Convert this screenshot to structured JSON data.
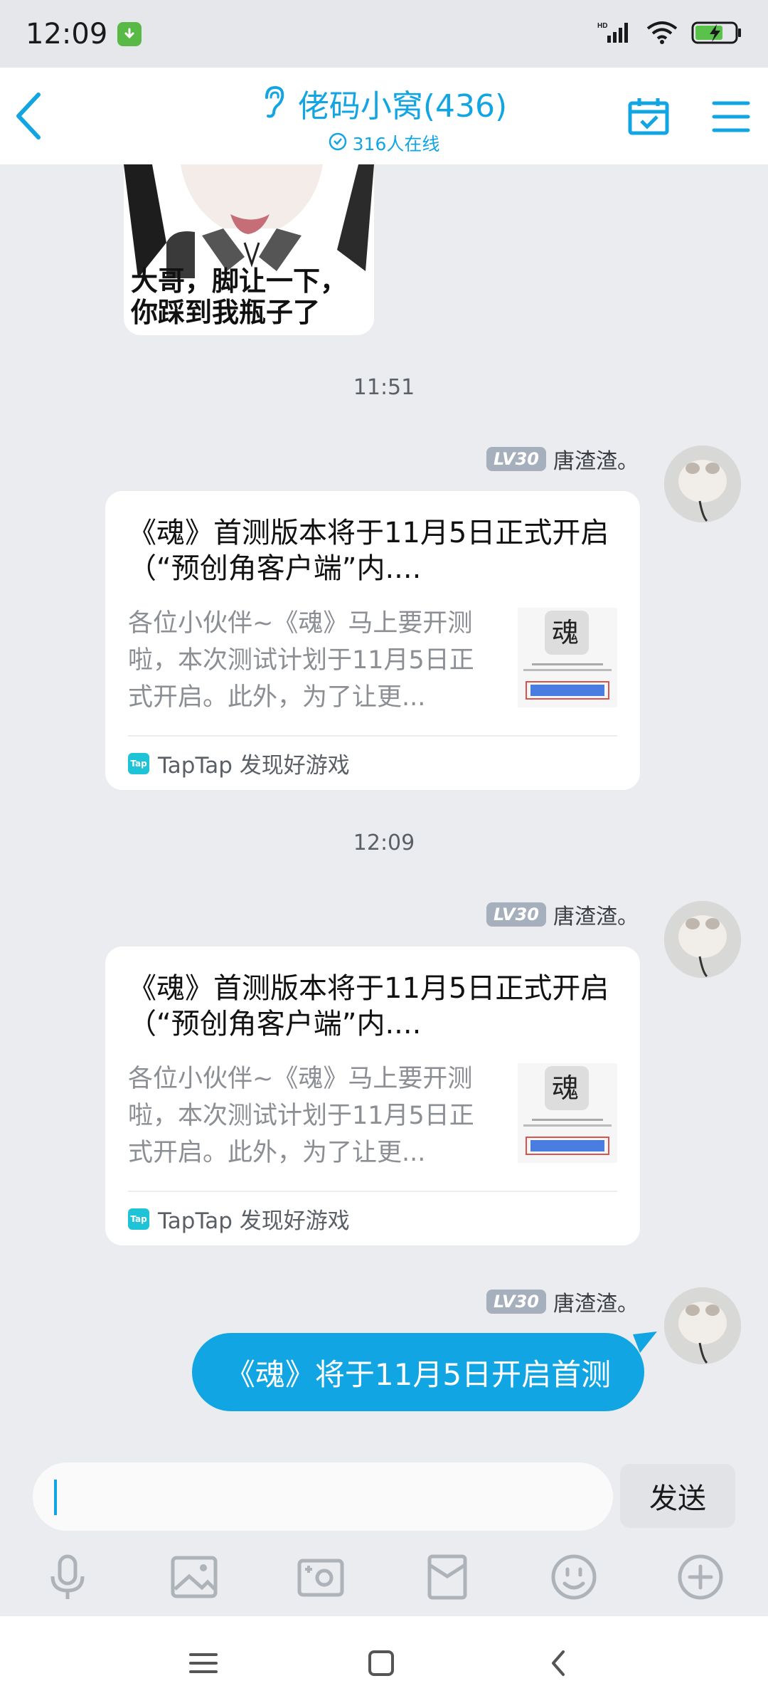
{
  "status_bar": {
    "time": "12:09",
    "icons": [
      "download-badge-icon",
      "hd-signal-icon",
      "wifi-icon",
      "battery-charging-icon"
    ]
  },
  "header": {
    "title": "佬码小窝(436)",
    "online_text": "316人在线",
    "icons": [
      "back-icon",
      "ear-icon",
      "check-circle-icon",
      "calendar-check-icon",
      "menu-icon"
    ],
    "accent_color": "#12a5e3"
  },
  "messages": [
    {
      "type": "sticker",
      "caption_line1": "大哥，脚让一下，",
      "caption_line2": "你踩到我瓶子了"
    },
    {
      "type": "time",
      "text": "11:51"
    },
    {
      "type": "card",
      "sender_level": "LV30",
      "sender_name": "唐渣渣。",
      "title": "《魂》首测版本将于11月5日正式开启（“预创角客户端”内....",
      "description": "各位小伙伴~《魂》马上要开测啦，本次测试计划于11月5日正式开启。此外，为了让更...",
      "source": "TapTap 发现好游戏"
    },
    {
      "type": "time",
      "text": "12:09"
    },
    {
      "type": "card",
      "sender_level": "LV30",
      "sender_name": "唐渣渣。",
      "title": "《魂》首测版本将于11月5日正式开启（“预创角客户端”内....",
      "description": "各位小伙伴~《魂》马上要开测啦，本次测试计划于11月5日正式开启。此外，为了让更...",
      "source": "TapTap 发现好游戏"
    },
    {
      "type": "text",
      "sender_level": "LV30",
      "sender_name": "唐渣渣。",
      "text": "《魂》将于11月5日开启首测"
    }
  ],
  "input": {
    "value": "",
    "send_label": "发送"
  },
  "toolbar_icons": [
    "microphone-icon",
    "image-icon",
    "camera-icon",
    "red-packet-icon",
    "emoji-icon",
    "plus-icon"
  ],
  "nav_icons": [
    "recents-icon",
    "home-icon",
    "back-nav-icon"
  ]
}
